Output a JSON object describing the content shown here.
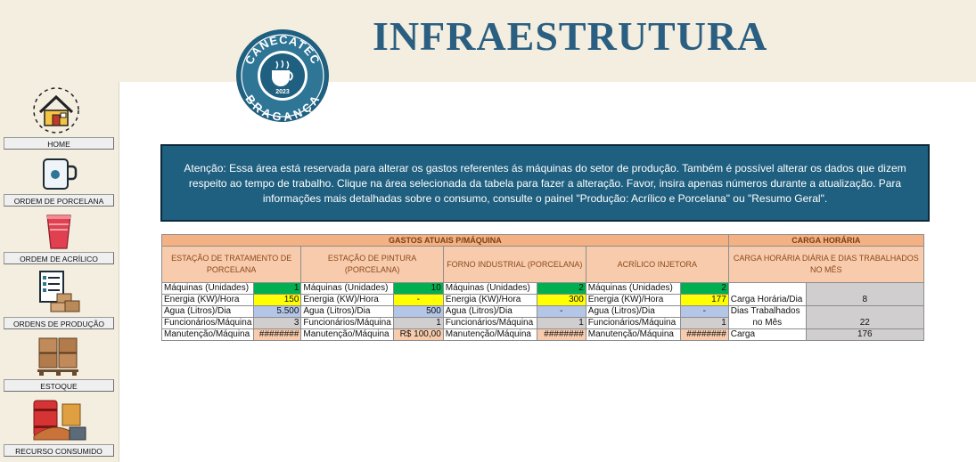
{
  "header": {
    "title": "INFRAESTRUTURA"
  },
  "logo": {
    "top_text": "CANECATEC",
    "bottom_text": "BRAGANÇA",
    "year": "2023",
    "brand_color": "#1f5f7f"
  },
  "sidebar": {
    "items": [
      {
        "label": "HOME",
        "icon": "house-icon"
      },
      {
        "label": "ORDEM DE PORCELANA",
        "icon": "mug-icon"
      },
      {
        "label": "ORDEM DE ACRÍLICO",
        "icon": "cup-icon"
      },
      {
        "label": "ORDENS DE PRODUÇÃO",
        "icon": "clipboard-boxes-icon"
      },
      {
        "label": "ESTOQUE",
        "icon": "boxes-pallet-icon"
      },
      {
        "label": "RECURSO CONSUMIDO",
        "icon": "barrels-icon"
      }
    ]
  },
  "notice": {
    "text": "Atenção: Essa área está reservada para alterar os gastos referentes ás máquinas do setor de produção. Também é possível alterar os dados que dizem respeito ao tempo de trabalho. Clique na área selecionada da tabela para fazer a alteração. Favor, insira apenas números durante a atualização. Para informações mais detalhadas sobre o consumo, consulte o painel \"Produção: Acrílico e Porcelana\" ou \"Resumo Geral\"."
  },
  "table": {
    "gastos_header": "GASTOS ATUAIS P/MÁQUINA",
    "carga_header": "CARGA HORÁRIA",
    "stations": [
      "ESTAÇÃO DE TRATAMENTO DE PORCELANA",
      "ESTAÇÃO DE PINTURA (PORCELANA)",
      "FORNO INDUSTRIAL (PORCELANA)",
      "ACRÍLICO INJETORA"
    ],
    "carga_sub": "CARGA HORÁRIA DIÁRIA E DIAS TRABALHADOS NO MÊS",
    "row_labels": [
      "Máquinas (Unidades)",
      "Energia (KW)/Hora",
      "Água (Litros)/Dia",
      "Funcionários/Máquina",
      "Manutenção/Máquina"
    ],
    "values": [
      [
        "1",
        "10",
        "2",
        "2"
      ],
      [
        "150",
        "-",
        "300",
        "177"
      ],
      [
        "5.500",
        "500",
        "-",
        "-"
      ],
      [
        "3",
        "1",
        "1",
        "1"
      ],
      [
        "########",
        "R$ 100,00",
        "########",
        "########"
      ]
    ],
    "carga": {
      "label_hours": "Carga Horária/Dia",
      "value_hours": "8",
      "label_days_1": "Dias Trabalhados",
      "label_days_2": "no Mês",
      "value_days": "22",
      "label_total": "Carga",
      "value_total": "176"
    }
  }
}
